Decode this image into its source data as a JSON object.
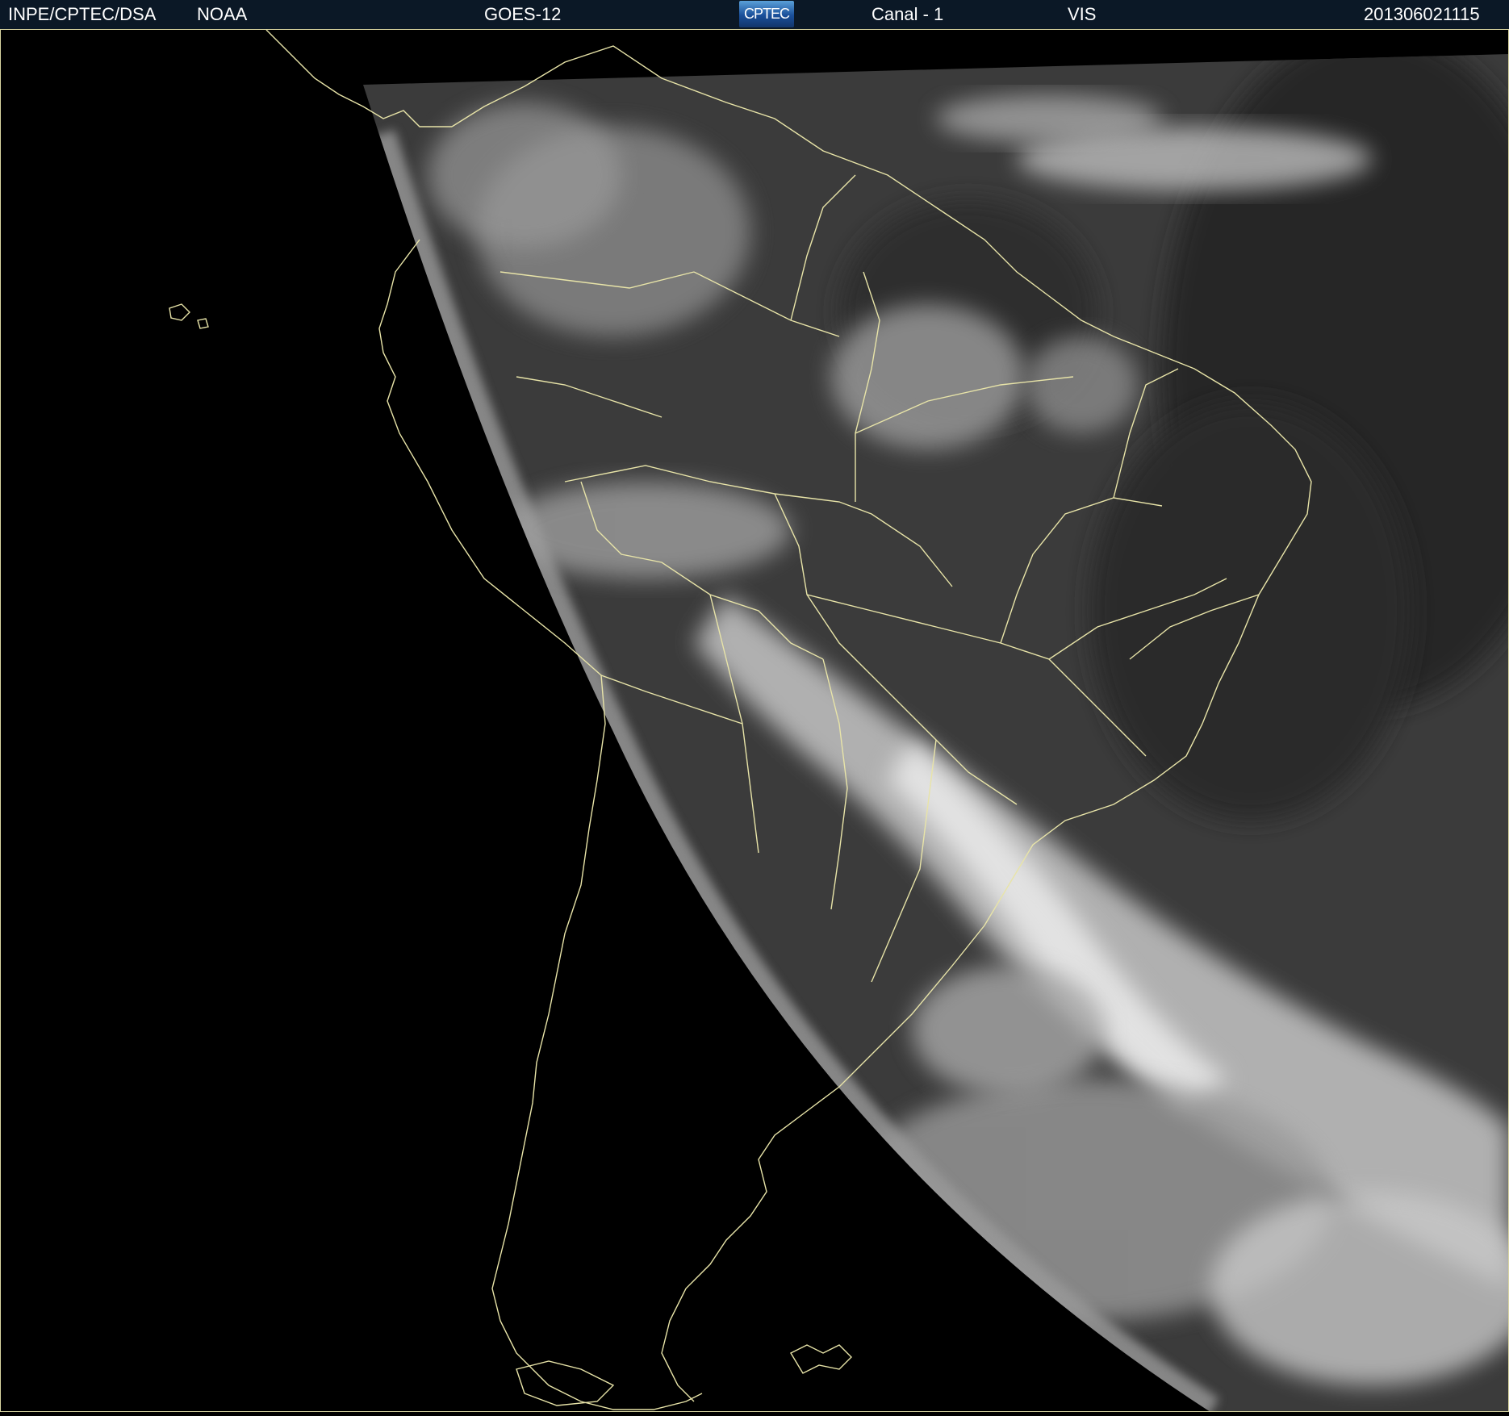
{
  "header": {
    "source": "INPE/CPTEC/DSA",
    "agency": "NOAA",
    "satellite": "GOES-12",
    "logo_text": "CPTEC",
    "channel": "Canal - 1",
    "band": "VIS",
    "timestamp": "201306021115"
  },
  "colors": {
    "background": "#000000",
    "header_bg": "#0b1826",
    "coastline": "#e8e4a8",
    "cloud": "#e6e6e6",
    "land": "#3a3a3a"
  },
  "icons": {
    "logo": "cptec-logo-icon"
  }
}
